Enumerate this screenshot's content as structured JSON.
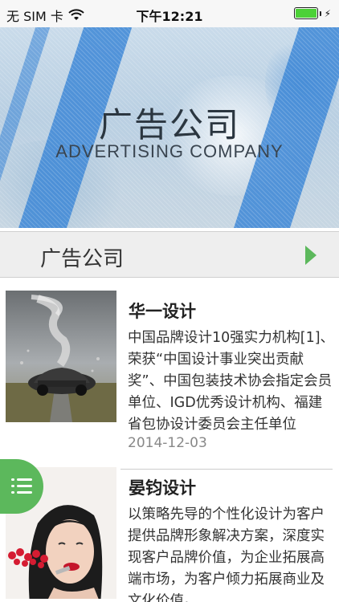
{
  "status_bar": {
    "carrier": "无 SIM 卡",
    "time": "下午12:21"
  },
  "banner": {
    "title": "广告公司",
    "subtitle": "ADVERTISING COMPANY"
  },
  "category": {
    "label": "广告公司",
    "accent_color": "#5cb85c"
  },
  "news": {
    "items": [
      {
        "title": "华一设计",
        "description": "中国品牌设计10强实力机构[1]、荣获“中国设计事业突出贡献奖”、中国包装技术协会指定会员单位、IGD优秀设计机构、福建省包协设计委员会主任单位",
        "date": "2014-12-03",
        "thumbnail_icon": "sports-car-tornado-image"
      },
      {
        "title": "晏钧设计",
        "description": "以策略先导的个性化设计为客户提供品牌形象解决方案，深度实现客户品牌价值，为企业拓展高端市场，为客户倾力拓展商业及文化价值。",
        "thumbnail_icon": "woman-lipstick-image"
      }
    ]
  },
  "menu": {
    "icon": "menu-list-icon",
    "color": "#5cb85c"
  }
}
